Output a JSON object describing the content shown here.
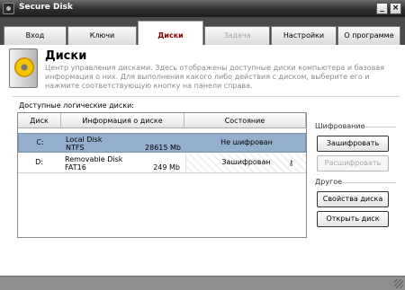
{
  "window": {
    "title": "Secure Disk"
  },
  "tabs": [
    {
      "label": "Вход",
      "state": "normal"
    },
    {
      "label": "Ключи",
      "state": "normal"
    },
    {
      "label": "Диски",
      "state": "active"
    },
    {
      "label": "Задача",
      "state": "disabled"
    },
    {
      "label": "Настройки",
      "state": "normal"
    },
    {
      "label": "О программе",
      "state": "normal"
    }
  ],
  "header": {
    "title": "Диски",
    "description": "Центр управления дисками. Здесь отображены доступные диски компьютера и базовая информация о них. Для выполнения какого либо действия с диском, выберите его и нажмите соответствующую кнопку на панели справа."
  },
  "disks": {
    "label": "Доступные логические диски:",
    "columns": [
      "Диск",
      "Информация о диске",
      "Состояние"
    ],
    "rows": [
      {
        "letter": "C:",
        "name": "Local Disk",
        "fs": "NTFS",
        "size": "28615 Mb",
        "state": "Не шифрован",
        "selected": true
      },
      {
        "letter": "D:",
        "name": "Removable Disk",
        "fs": "FAT16",
        "size": "249 Mb",
        "state": "Зашифрован",
        "selected": false
      }
    ]
  },
  "side": {
    "encryption_label": "Шифрование",
    "encrypt_button": "Зашифровать",
    "decrypt_button": "Расшифровать",
    "other_label": "Другое",
    "props_button": "Свойства диска",
    "open_button": "Открыть диск"
  },
  "colors": {
    "selected_row": "#95b0ce",
    "active_tab_text": "#8b0000",
    "titlebar": "#2e2e2e"
  }
}
